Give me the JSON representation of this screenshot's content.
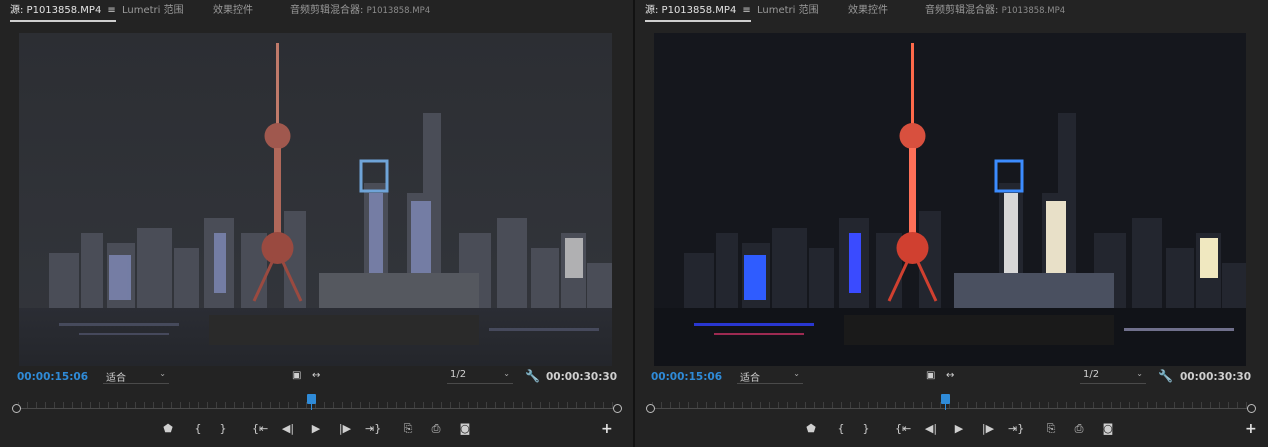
{
  "panels": [
    {
      "tabs": {
        "source": "源: P1013858.MP4",
        "lumetri": "Lumetri 范围",
        "effects": "效果控件",
        "mixer": "音频剪辑混合器:",
        "mixer_file": "P1013858.MP4"
      },
      "timecode_current": "00:00:15:06",
      "zoom": "适合",
      "resolution": "1/2",
      "timecode_duration": "00:00:30:30",
      "playhead_fraction": 0.49
    },
    {
      "tabs": {
        "source": "源: P1013858.MP4",
        "lumetri": "Lumetri 范围",
        "effects": "效果控件",
        "mixer": "音频剪辑混合器:",
        "mixer_file": "P1013858.MP4"
      },
      "timecode_current": "00:00:15:06",
      "zoom": "适合",
      "resolution": "1/2",
      "timecode_duration": "00:00:30:30",
      "playhead_fraction": 0.49
    }
  ],
  "icons": {
    "menu": "hamburger-menu-icon",
    "wrench": "wrench-icon",
    "add": "plus-icon",
    "transport": [
      "marker-icon",
      "mark-in-icon",
      "mark-out-icon",
      "go-to-in-icon",
      "step-back-icon",
      "play-icon",
      "step-forward-icon",
      "go-to-out-icon",
      "insert-icon",
      "overwrite-icon",
      "export-frame-icon"
    ]
  },
  "colors": {
    "accent": "#2f8bd8",
    "background": "#232323",
    "text": "#cfcfcf"
  }
}
